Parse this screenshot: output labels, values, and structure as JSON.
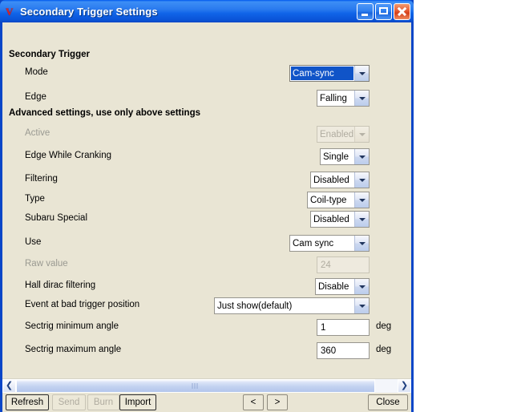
{
  "window": {
    "title": "Secondary Trigger Settings",
    "icon": "app-logo-v-icon",
    "controls": {
      "minimize": "minimize-icon",
      "maximize": "maximize-icon",
      "close": "close-icon"
    }
  },
  "sections": [
    {
      "id": "secondary-trigger",
      "title": "Secondary Trigger"
    },
    {
      "id": "advanced-settings",
      "title": "Advanced settings, use only above settings"
    }
  ],
  "rows": [
    {
      "label": "Mode",
      "type": "combo",
      "value": "Cam-sync",
      "state": "focused"
    },
    {
      "label": "Edge",
      "type": "combo",
      "value": "Falling",
      "state": "normal"
    },
    {
      "label": "Active",
      "type": "combo",
      "value": "Enabled",
      "state": "disabled"
    },
    {
      "label": "Edge While Cranking",
      "type": "combo",
      "value": "Single",
      "state": "normal"
    },
    {
      "label": "Filtering",
      "type": "combo",
      "value": "Disabled",
      "state": "normal"
    },
    {
      "label": "Type",
      "type": "combo",
      "value": "Coil-type",
      "state": "normal"
    },
    {
      "label": "Subaru Special",
      "type": "combo",
      "value": "Disabled",
      "state": "normal"
    },
    {
      "label": "Use",
      "type": "combo",
      "value": "Cam sync",
      "state": "normal"
    },
    {
      "label": "Raw value",
      "type": "field",
      "value": "24",
      "state": "disabled",
      "unit": ""
    },
    {
      "label": "Hall dirac filtering",
      "type": "combo",
      "value": "Disable",
      "state": "normal"
    },
    {
      "label": "Event at bad trigger position",
      "type": "combo",
      "value": "Just show(default)",
      "state": "normal"
    },
    {
      "label": "Sectrig minimum angle",
      "type": "field",
      "value": "1",
      "state": "normal",
      "unit": "deg"
    },
    {
      "label": "Sectrig maximum angle",
      "type": "field",
      "value": "360",
      "state": "normal",
      "unit": "deg"
    }
  ],
  "scrollbar": {
    "left_arrow": "chevron-left-icon",
    "right_arrow": "chevron-right-icon"
  },
  "buttons": [
    {
      "label": "Refresh",
      "state": "default"
    },
    {
      "label": "Send",
      "state": "disabled"
    },
    {
      "label": "Burn",
      "state": "disabled"
    },
    {
      "label": "Import",
      "state": "default"
    },
    {
      "label": "<",
      "state": "normal"
    },
    {
      "label": ">",
      "state": "normal"
    },
    {
      "label": "Close",
      "state": "normal"
    }
  ]
}
